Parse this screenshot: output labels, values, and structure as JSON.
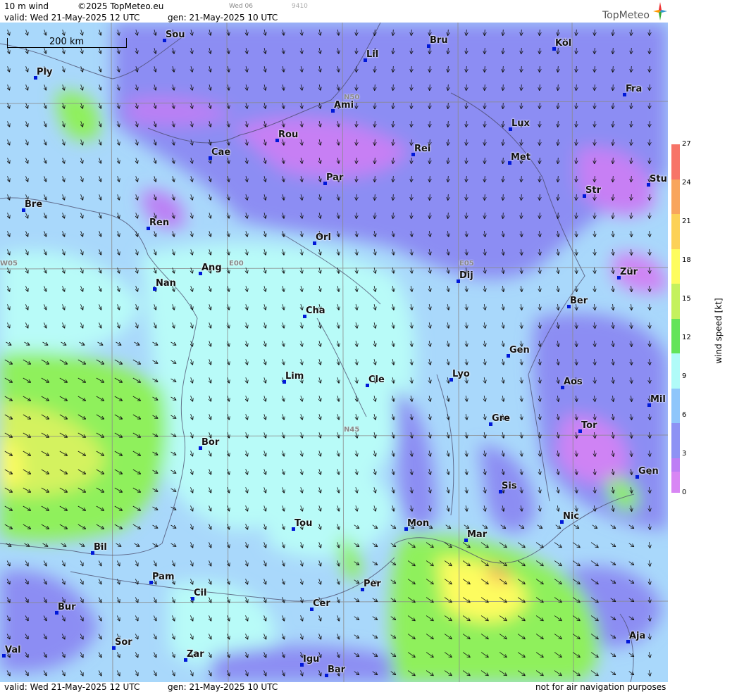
{
  "header": {
    "product": "10 m wind",
    "copyright": "©2025 TopMeteo.eu",
    "tab": "Wed 06",
    "code": "9410",
    "valid": "valid:  Wed  21-May-2025  12 UTC",
    "gen": "gen: 21-May-2025 10 UTC",
    "logo": "TopMeteo"
  },
  "footer": {
    "valid": "valid:  Wed  21-May-2025  12 UTC",
    "gen": "gen: 21-May-2025 10 UTC",
    "disclaimer": "not for air navigation purposes"
  },
  "scale_bar": {
    "label": "200 km"
  },
  "grid_labels": [
    "N50",
    "E00",
    "E05",
    "W05",
    "N45"
  ],
  "cities": [
    "Sou",
    "Bru",
    "Köl",
    "Lil",
    "Ply",
    "Ami",
    "Fra",
    "Lux",
    "Rou",
    "Cae",
    "Rei",
    "Met",
    "Par",
    "Stu",
    "Str",
    "Bre",
    "Ren",
    "Orl",
    "Ang",
    "Dij",
    "Zür",
    "Nan",
    "Ber",
    "Cha",
    "Gen",
    "Lyo",
    "Lim",
    "Cle",
    "Aos",
    "Mil",
    "Gre",
    "Tor",
    "Bor",
    "Gen",
    "Sis",
    "Nic",
    "Tou",
    "Mon",
    "Mar",
    "Bil",
    "Pam",
    "Per",
    "Cil",
    "Bur",
    "Cer",
    "Aja",
    "Sor",
    "Val",
    "Zar",
    "Igu",
    "Bar"
  ],
  "colorbar": {
    "title": "wind speed [kt]",
    "ticks": [
      "27",
      "24",
      "21",
      "18",
      "15",
      "12",
      "9",
      "6",
      "3",
      "0"
    ],
    "colors": [
      "#f77468",
      "#f8a55d",
      "#fcd157",
      "#fdfc5e",
      "#c4f15d",
      "#63e459",
      "#b0fbf8",
      "#8fc6fb",
      "#8d92f4",
      "#bd7ef5",
      "#d886f4"
    ]
  }
}
